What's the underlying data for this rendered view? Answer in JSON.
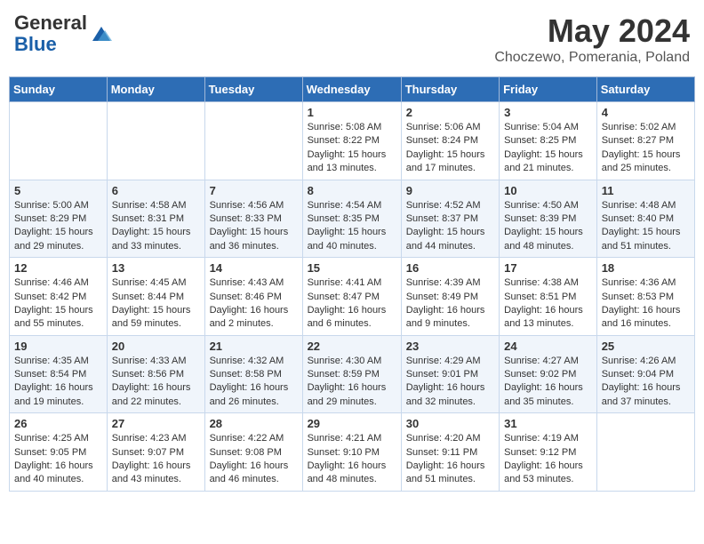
{
  "header": {
    "logo_general": "General",
    "logo_blue": "Blue",
    "title": "May 2024",
    "subtitle": "Choczewo, Pomerania, Poland"
  },
  "weekdays": [
    "Sunday",
    "Monday",
    "Tuesday",
    "Wednesday",
    "Thursday",
    "Friday",
    "Saturday"
  ],
  "weeks": [
    [
      {
        "day": "",
        "sunrise": "",
        "sunset": "",
        "daylight": ""
      },
      {
        "day": "",
        "sunrise": "",
        "sunset": "",
        "daylight": ""
      },
      {
        "day": "",
        "sunrise": "",
        "sunset": "",
        "daylight": ""
      },
      {
        "day": "1",
        "sunrise": "Sunrise: 5:08 AM",
        "sunset": "Sunset: 8:22 PM",
        "daylight": "Daylight: 15 hours and 13 minutes."
      },
      {
        "day": "2",
        "sunrise": "Sunrise: 5:06 AM",
        "sunset": "Sunset: 8:24 PM",
        "daylight": "Daylight: 15 hours and 17 minutes."
      },
      {
        "day": "3",
        "sunrise": "Sunrise: 5:04 AM",
        "sunset": "Sunset: 8:25 PM",
        "daylight": "Daylight: 15 hours and 21 minutes."
      },
      {
        "day": "4",
        "sunrise": "Sunrise: 5:02 AM",
        "sunset": "Sunset: 8:27 PM",
        "daylight": "Daylight: 15 hours and 25 minutes."
      }
    ],
    [
      {
        "day": "5",
        "sunrise": "Sunrise: 5:00 AM",
        "sunset": "Sunset: 8:29 PM",
        "daylight": "Daylight: 15 hours and 29 minutes."
      },
      {
        "day": "6",
        "sunrise": "Sunrise: 4:58 AM",
        "sunset": "Sunset: 8:31 PM",
        "daylight": "Daylight: 15 hours and 33 minutes."
      },
      {
        "day": "7",
        "sunrise": "Sunrise: 4:56 AM",
        "sunset": "Sunset: 8:33 PM",
        "daylight": "Daylight: 15 hours and 36 minutes."
      },
      {
        "day": "8",
        "sunrise": "Sunrise: 4:54 AM",
        "sunset": "Sunset: 8:35 PM",
        "daylight": "Daylight: 15 hours and 40 minutes."
      },
      {
        "day": "9",
        "sunrise": "Sunrise: 4:52 AM",
        "sunset": "Sunset: 8:37 PM",
        "daylight": "Daylight: 15 hours and 44 minutes."
      },
      {
        "day": "10",
        "sunrise": "Sunrise: 4:50 AM",
        "sunset": "Sunset: 8:39 PM",
        "daylight": "Daylight: 15 hours and 48 minutes."
      },
      {
        "day": "11",
        "sunrise": "Sunrise: 4:48 AM",
        "sunset": "Sunset: 8:40 PM",
        "daylight": "Daylight: 15 hours and 51 minutes."
      }
    ],
    [
      {
        "day": "12",
        "sunrise": "Sunrise: 4:46 AM",
        "sunset": "Sunset: 8:42 PM",
        "daylight": "Daylight: 15 hours and 55 minutes."
      },
      {
        "day": "13",
        "sunrise": "Sunrise: 4:45 AM",
        "sunset": "Sunset: 8:44 PM",
        "daylight": "Daylight: 15 hours and 59 minutes."
      },
      {
        "day": "14",
        "sunrise": "Sunrise: 4:43 AM",
        "sunset": "Sunset: 8:46 PM",
        "daylight": "Daylight: 16 hours and 2 minutes."
      },
      {
        "day": "15",
        "sunrise": "Sunrise: 4:41 AM",
        "sunset": "Sunset: 8:47 PM",
        "daylight": "Daylight: 16 hours and 6 minutes."
      },
      {
        "day": "16",
        "sunrise": "Sunrise: 4:39 AM",
        "sunset": "Sunset: 8:49 PM",
        "daylight": "Daylight: 16 hours and 9 minutes."
      },
      {
        "day": "17",
        "sunrise": "Sunrise: 4:38 AM",
        "sunset": "Sunset: 8:51 PM",
        "daylight": "Daylight: 16 hours and 13 minutes."
      },
      {
        "day": "18",
        "sunrise": "Sunrise: 4:36 AM",
        "sunset": "Sunset: 8:53 PM",
        "daylight": "Daylight: 16 hours and 16 minutes."
      }
    ],
    [
      {
        "day": "19",
        "sunrise": "Sunrise: 4:35 AM",
        "sunset": "Sunset: 8:54 PM",
        "daylight": "Daylight: 16 hours and 19 minutes."
      },
      {
        "day": "20",
        "sunrise": "Sunrise: 4:33 AM",
        "sunset": "Sunset: 8:56 PM",
        "daylight": "Daylight: 16 hours and 22 minutes."
      },
      {
        "day": "21",
        "sunrise": "Sunrise: 4:32 AM",
        "sunset": "Sunset: 8:58 PM",
        "daylight": "Daylight: 16 hours and 26 minutes."
      },
      {
        "day": "22",
        "sunrise": "Sunrise: 4:30 AM",
        "sunset": "Sunset: 8:59 PM",
        "daylight": "Daylight: 16 hours and 29 minutes."
      },
      {
        "day": "23",
        "sunrise": "Sunrise: 4:29 AM",
        "sunset": "Sunset: 9:01 PM",
        "daylight": "Daylight: 16 hours and 32 minutes."
      },
      {
        "day": "24",
        "sunrise": "Sunrise: 4:27 AM",
        "sunset": "Sunset: 9:02 PM",
        "daylight": "Daylight: 16 hours and 35 minutes."
      },
      {
        "day": "25",
        "sunrise": "Sunrise: 4:26 AM",
        "sunset": "Sunset: 9:04 PM",
        "daylight": "Daylight: 16 hours and 37 minutes."
      }
    ],
    [
      {
        "day": "26",
        "sunrise": "Sunrise: 4:25 AM",
        "sunset": "Sunset: 9:05 PM",
        "daylight": "Daylight: 16 hours and 40 minutes."
      },
      {
        "day": "27",
        "sunrise": "Sunrise: 4:23 AM",
        "sunset": "Sunset: 9:07 PM",
        "daylight": "Daylight: 16 hours and 43 minutes."
      },
      {
        "day": "28",
        "sunrise": "Sunrise: 4:22 AM",
        "sunset": "Sunset: 9:08 PM",
        "daylight": "Daylight: 16 hours and 46 minutes."
      },
      {
        "day": "29",
        "sunrise": "Sunrise: 4:21 AM",
        "sunset": "Sunset: 9:10 PM",
        "daylight": "Daylight: 16 hours and 48 minutes."
      },
      {
        "day": "30",
        "sunrise": "Sunrise: 4:20 AM",
        "sunset": "Sunset: 9:11 PM",
        "daylight": "Daylight: 16 hours and 51 minutes."
      },
      {
        "day": "31",
        "sunrise": "Sunrise: 4:19 AM",
        "sunset": "Sunset: 9:12 PM",
        "daylight": "Daylight: 16 hours and 53 minutes."
      },
      {
        "day": "",
        "sunrise": "",
        "sunset": "",
        "daylight": ""
      }
    ]
  ]
}
